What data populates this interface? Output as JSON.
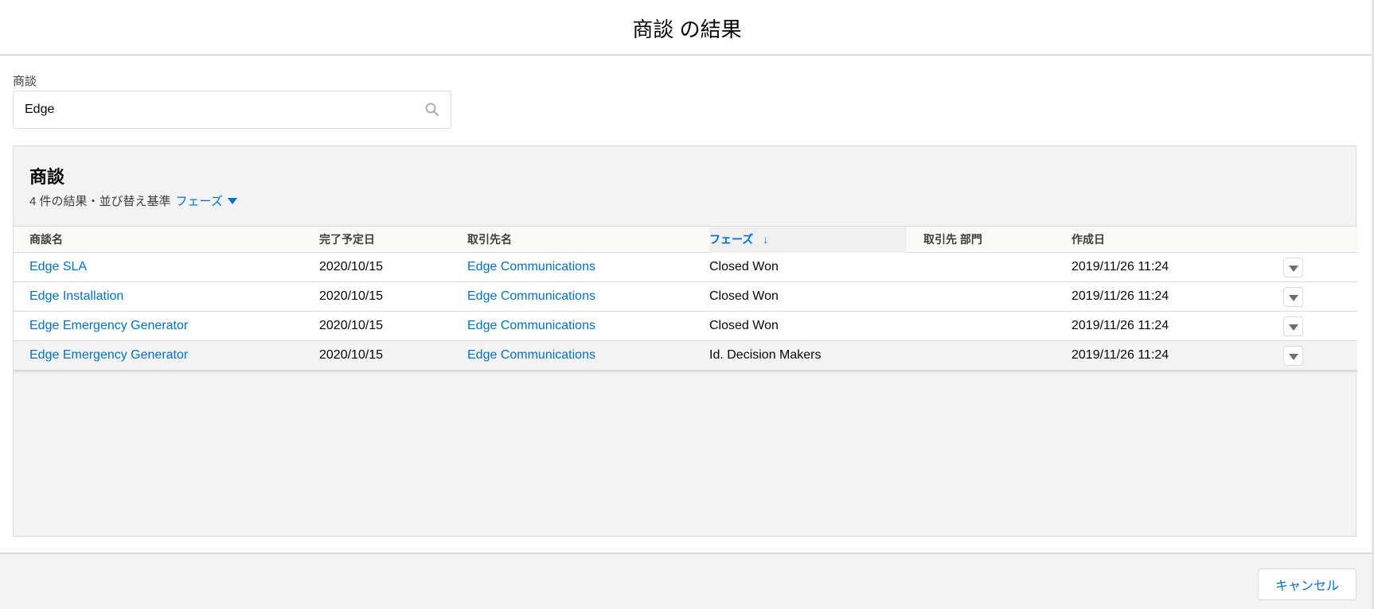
{
  "modal": {
    "title": "商談 の結果"
  },
  "search": {
    "label": "商談",
    "value": "Edge"
  },
  "results": {
    "title": "商談",
    "summary": "4 件の結果・並び替え基準",
    "sort_field": "フェーズ"
  },
  "table": {
    "columns": {
      "name": "商談名",
      "close_date": "完了予定日",
      "account": "取引先名",
      "stage": "フェーズ",
      "stage_sort_arrow": "↓",
      "department": "取引先 部門",
      "created": "作成日"
    },
    "rows": [
      {
        "name": "Edge SLA",
        "close_date": "2020/10/15",
        "account": "Edge Communications",
        "stage": "Closed Won",
        "department": "",
        "created": "2019/11/26 11:24"
      },
      {
        "name": "Edge Installation",
        "close_date": "2020/10/15",
        "account": "Edge Communications",
        "stage": "Closed Won",
        "department": "",
        "created": "2019/11/26 11:24"
      },
      {
        "name": "Edge Emergency Generator",
        "close_date": "2020/10/15",
        "account": "Edge Communications",
        "stage": "Closed Won",
        "department": "",
        "created": "2019/11/26 11:24"
      },
      {
        "name": "Edge Emergency Generator",
        "close_date": "2020/10/15",
        "account": "Edge Communications",
        "stage": "Id. Decision Makers",
        "department": "",
        "created": "2019/11/26 11:24"
      }
    ]
  },
  "footer": {
    "cancel_label": "キャンセル"
  },
  "icons": {
    "search": "search-icon",
    "row_menu": "chevron-down-icon",
    "sort": "arrow-down-icon"
  },
  "colors": {
    "link": "#0070d2",
    "panel": "#f3f3f3",
    "border": "#dddbda"
  }
}
